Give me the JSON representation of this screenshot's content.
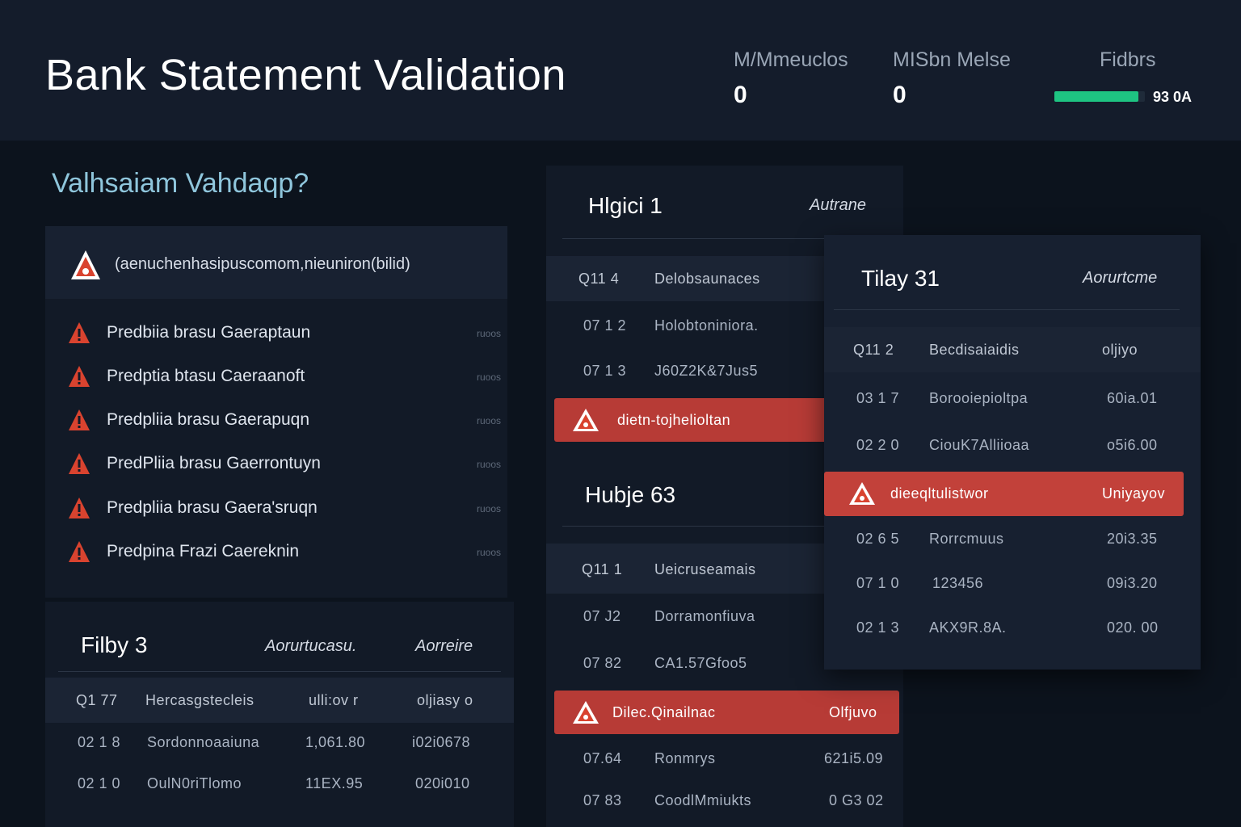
{
  "header": {
    "title": "Bank Statement Validation",
    "stats": [
      {
        "label": "M/Mmeuclos",
        "value": "0"
      },
      {
        "label": "MISbn Melse",
        "value": "0"
      },
      {
        "label": "Fidbrs",
        "progress_percent": 93,
        "value": "93 0A"
      }
    ]
  },
  "alerts": {
    "heading": "Valhsaiam Vahdaqp?",
    "summary": "(aenuchenhasipuscomom,nieuniron(bilid)",
    "items": [
      {
        "label": "Predbiia brasu Gaeraptaun",
        "meta": "ruoos"
      },
      {
        "label": "Predptia btasu Caeraanoft",
        "meta": "ruoos"
      },
      {
        "label": "Predpliia brasu Gaerapuqn",
        "meta": "ruoos"
      },
      {
        "label": "PredPliia brasu Gaerrontuyn",
        "meta": "ruoos"
      },
      {
        "label": "Predpliia brasu Gaera'sruqn",
        "meta": "ruoos"
      },
      {
        "label": "Predpina Frazi Caereknin",
        "meta": "ruoos"
      }
    ]
  },
  "panel_a": {
    "title": "Filby 3",
    "status_1": "Aorurtucasu.",
    "status_2": "Aorreire",
    "header_row": [
      "Q1 77",
      "Hercasgstecleis",
      "ulli:ov r",
      "oljiasy o"
    ],
    "rows": [
      [
        "02 1 8",
        "Sordonnoaaiuna",
        "1,061.80",
        "i02i0678"
      ],
      [
        "02 1 0",
        "OulN0riTlomo",
        "11EX.95",
        "020i010"
      ]
    ]
  },
  "panel_b": {
    "group_1": {
      "title": "Hlgici 1",
      "status": "Autrane",
      "header_row": [
        "Q11 4",
        "Delobsaunaces"
      ],
      "rows": [
        [
          "07 1 2",
          "Holobtoniniora."
        ],
        [
          "07 1 3",
          "J60Z2K&7Jus5"
        ]
      ],
      "flag": "dietn-tojhelioltan"
    },
    "group_2": {
      "title": "Hubje 63",
      "header_row": [
        "Q11 1",
        "Ueicruseamais"
      ],
      "rows": [
        [
          "07 J2",
          "Dorramonfiuva"
        ],
        [
          "07 82",
          "CA1.57Gfoo5"
        ]
      ],
      "flag": "Dilec.Qinailnac",
      "flag_meta": "Olfjuvo",
      "rows_after": [
        [
          "07.64",
          "Ronmrys",
          "621i5.09"
        ],
        [
          "07 83",
          "CoodlMmiukts",
          "0 G3 02"
        ]
      ]
    }
  },
  "panel_c": {
    "title": "Tilay 31",
    "status": "Aorurtcme",
    "header_row": [
      "Q11 2",
      "Becdisaiaidis",
      "oljiyo"
    ],
    "rows": [
      [
        "03 1 7",
        "Borooiepioltpa",
        "60ia.01"
      ],
      [
        "02 2 0",
        "CiouK7Alliioaa",
        "o5i6.00"
      ]
    ],
    "flag": "dieeqltulistwor",
    "flag_meta": "Uniyayov",
    "rows_after": [
      [
        "02 6 5",
        "Rorrcmuus",
        "20i3.35"
      ],
      [
        "07 1 0",
        "123456",
        "09i3.20"
      ],
      [
        "02 1 3",
        "AKX9R.8A.",
        "020. 00"
      ]
    ]
  },
  "colors": {
    "background": "#0c131d",
    "header_bg": "#141c2b",
    "accent_green": "#1ec482",
    "alert_red": "#d9432f",
    "flag_red": "#b73b36",
    "heading_cyan": "#8fc6dc"
  }
}
